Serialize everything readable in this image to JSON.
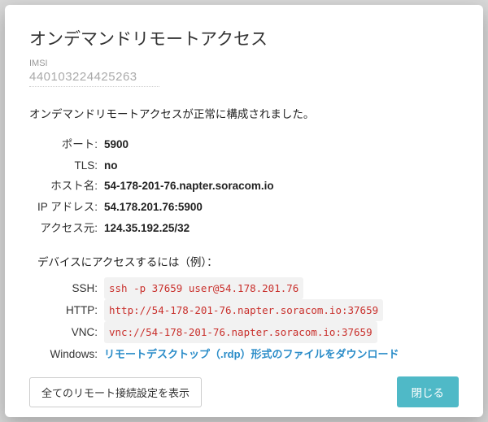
{
  "modal": {
    "title": "オンデマンドリモートアクセス",
    "imsi_label": "IMSI",
    "imsi_value": "440103224425263",
    "status": "オンデマンドリモートアクセスが正常に構成されました。"
  },
  "details": {
    "port_label": "ポート:",
    "port_value": "5900",
    "tls_label": "TLS:",
    "tls_value": "no",
    "host_label": "ホスト名:",
    "host_value": "54-178-201-76.napter.soracom.io",
    "ip_label": "IP アドレス:",
    "ip_value": "54.178.201.76:5900",
    "src_label": "アクセス元:",
    "src_value": "124.35.192.25/32"
  },
  "examples": {
    "title": "デバイスにアクセスするには（例）：",
    "ssh_label": "SSH:",
    "ssh_value": "ssh -p 37659 user@54.178.201.76",
    "http_label": "HTTP:",
    "http_value": "http://54-178-201-76.napter.soracom.io:37659",
    "vnc_label": "VNC:",
    "vnc_value": "vnc://54-178-201-76.napter.soracom.io:37659",
    "win_label": "Windows:",
    "win_link": "リモートデスクトップ（.rdp）形式のファイルをダウンロード"
  },
  "footer": {
    "show_all": "全てのリモート接続設定を表示",
    "close": "閉じる"
  }
}
